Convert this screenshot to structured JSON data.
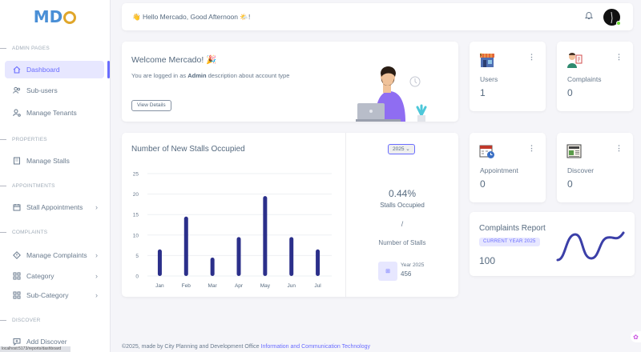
{
  "brand": {
    "logo_text": "MDC"
  },
  "topbar": {
    "greeting": "👋 Hello Mercado, Good Afternoon 🌤️!"
  },
  "sidebar": {
    "sections": {
      "admin": "ADMIN PAGES",
      "properties": "PROPERTIES",
      "appointments": "APPOINTMENTS",
      "complaints": "COMPLAINTS",
      "discover": "DISCOVER"
    },
    "items": {
      "dashboard": "Dashboard",
      "subusers": "Sub-users",
      "tenants": "Manage Tenants",
      "stalls": "Manage Stalls",
      "stall_appointments": "Stall Appointments",
      "manage_complaints": "Manage Complaints",
      "category": "Category",
      "subcategory": "Sub-Category",
      "add_discover": "Add Discover"
    },
    "status_url": "localhost:5173/reports/dashboard"
  },
  "welcome": {
    "title": "Welcome Mercado! 🎉",
    "text_before": "You are logged in as ",
    "role": "Admin",
    "text_after": " description about account type",
    "button": "View Details"
  },
  "stats": {
    "users": {
      "label": "Users",
      "value": "1",
      "more": "⋮"
    },
    "complaints": {
      "label": "Complaints",
      "value": "0",
      "more": "⋮"
    },
    "appointment": {
      "label": "Appointment",
      "value": "0",
      "more": "⋮"
    },
    "discover": {
      "label": "Discover",
      "value": "0",
      "more": "⋮"
    }
  },
  "chart_card": {
    "year_select": "2025 ⌄",
    "percent": "0.44%",
    "percent_label": "Stalls Occupied",
    "slash": "/",
    "number_label": "Number of Stalls",
    "year_text": "Year 2025",
    "year_value": "456"
  },
  "chart_data": {
    "type": "bar",
    "title": "Number of New Stalls Occupied",
    "categories": [
      "Jan",
      "Feb",
      "Mar",
      "Apr",
      "May",
      "Jun",
      "Jul"
    ],
    "values": [
      6.5,
      14.5,
      4.5,
      9.5,
      19.5,
      9.5,
      6.5
    ],
    "yticks": [
      "0",
      "5",
      "10",
      "15",
      "20",
      "25"
    ],
    "ylim": [
      0,
      25
    ],
    "grid": true,
    "color": "#2b2f8a"
  },
  "report": {
    "title": "Complaints Report",
    "badge": "CURRENT YEAR 2025",
    "value": "100",
    "line_color": "#3b3fa8"
  },
  "footer": {
    "prefix": "©2025, made by City Planning and Development Office ",
    "link": "Information and Communication Technology"
  },
  "colors": {
    "accent": "#696cff",
    "active_bg": "#e7e7ff",
    "background": "#f5f5f9"
  }
}
